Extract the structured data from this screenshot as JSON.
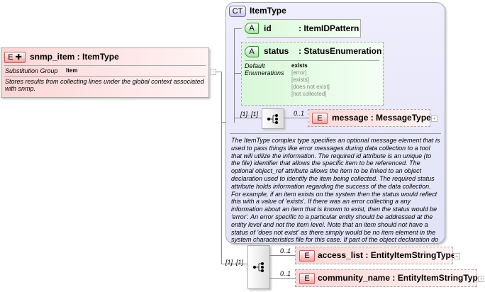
{
  "element": {
    "badge": "E",
    "name": "snmp_item : ItemType",
    "subst_label": "Substitution Group",
    "subst_value": "Item",
    "doc": "Stores results from collecting lines under the global context associated with snmp."
  },
  "complex_type": {
    "badge": "CT",
    "name": "ItemType",
    "id_attr": {
      "badge": "A",
      "name": "id",
      "type": ": ItemIDPattern"
    },
    "status_attr": {
      "badge": "A",
      "name": "status",
      "type": ": StatusEnumeration",
      "default_label": "Default",
      "enum_label": "Enumerations",
      "default_value": "exists",
      "enumerations": [
        "[error]",
        "[exists]",
        "[does not exist]",
        "[not collected]"
      ]
    },
    "sequence_card": "[1]..[1]",
    "message": {
      "badge": "E",
      "name": "message : MessageType",
      "card": "0..1"
    },
    "doc": "The ItemType complex type specifies an optional message element that is used to pass things like error messages during data collection to a tool that will utilize the information. The required id attribute is an unique (to the file) identifier that allows the specific item to be referenced. The optional object_ref attribute allows the item to be linked to an object declaration used to identify the item being collected. The required status attribute holds information regarding the success of the data collection. For example, if an item exists on the system then the status would reflect this with a value of 'exists'. If there was an error collecting a any information about an item that is known to exist, then the status would be 'error'. An error specific to a particular entity should be addressed at the entity level and not the item level. Note that an item should not have a status of 'does not exist' as there simply would be no item element in the system characteristics file for this case. If part of the object declaration do"
  },
  "sequence": {
    "card": "[1]..[1]",
    "children": [
      {
        "badge": "E",
        "name": "access_list : EntityItemStringType",
        "card": "0..1"
      },
      {
        "badge": "E",
        "name": "community_name : EntityItemStringType",
        "card": "0..1"
      }
    ]
  }
}
